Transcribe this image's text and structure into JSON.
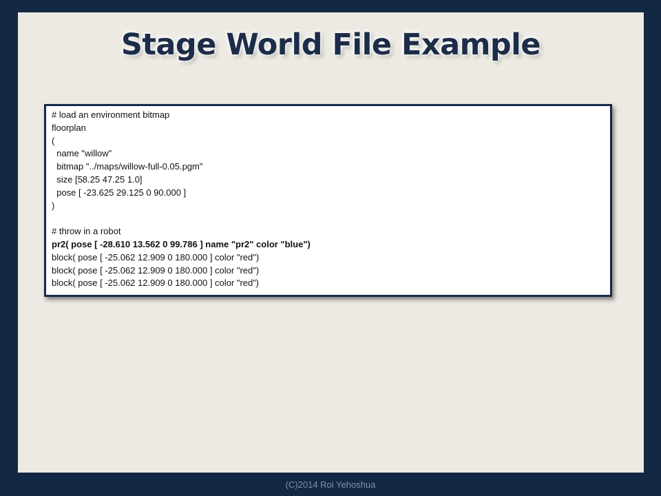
{
  "slide": {
    "title": "Stage World File Example",
    "code_lines": [
      "# load an environment bitmap",
      "floorplan",
      "(",
      "  name \"willow\"",
      "  bitmap \"../maps/willow-full-0.05.pgm\"",
      "  size [58.25 47.25 1.0]",
      "  pose [ -23.625 29.125 0 90.000 ]",
      ")",
      "",
      "# throw in a robot",
      "pr2( pose [ -28.610 13.562 0 99.786 ] name \"pr2\" color \"blue\")",
      "block( pose [ -25.062 12.909 0 180.000 ] color \"red\")",
      "block( pose [ -25.062 12.909 0 180.000 ] color \"red\")",
      "block( pose [ -25.062 12.909 0 180.000 ] color \"red”)"
    ],
    "footer": "(C)2014 Roi Yehoshua"
  }
}
